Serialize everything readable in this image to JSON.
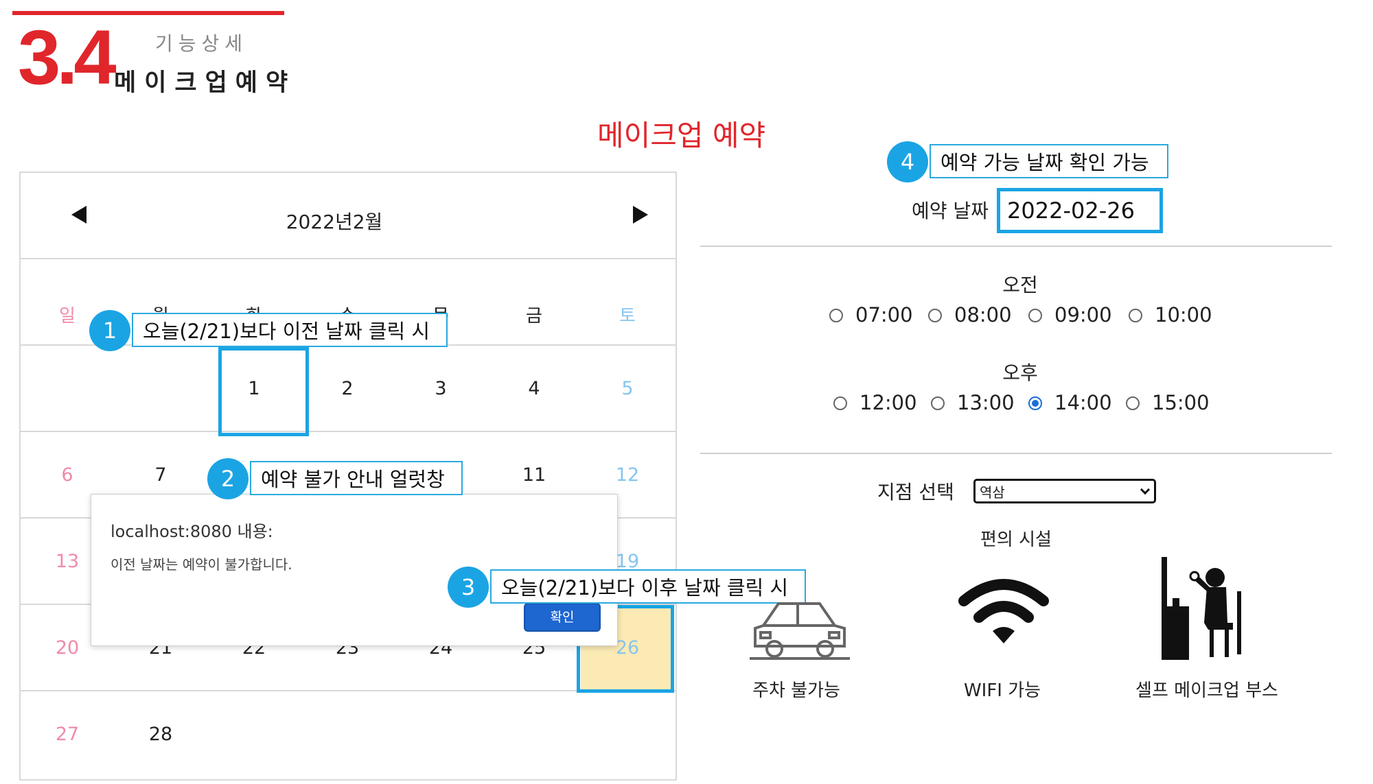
{
  "header": {
    "section_number": "3.4",
    "subtitle": "기능상세",
    "title": "메이크업예약"
  },
  "page_title": "메이크업 예약",
  "calendar": {
    "month_label": "2022년2월",
    "weekdays": [
      "일",
      "월",
      "화",
      "수",
      "목",
      "금",
      "토"
    ],
    "weeks": [
      [
        "",
        "",
        "1",
        "2",
        "3",
        "4",
        "5"
      ],
      [
        "6",
        "7",
        "",
        "",
        "",
        "11",
        "12"
      ],
      [
        "13",
        "",
        "",
        "",
        "",
        "",
        "19"
      ],
      [
        "20",
        "21",
        "22",
        "23",
        "24",
        "25",
        "26"
      ],
      [
        "27",
        "28",
        "",
        "",
        "",
        "",
        ""
      ]
    ],
    "selected_day": "26"
  },
  "alert": {
    "title": "localhost:8080 내용:",
    "message": "이전 날짜는 예약이 불가합니다.",
    "ok_label": "확인"
  },
  "callouts": [
    {
      "number": "1",
      "text": "오늘(2/21)보다 이전 날짜 클릭 시"
    },
    {
      "number": "2",
      "text": "예약 불가 안내 얼럿창"
    },
    {
      "number": "3",
      "text": "오늘(2/21)보다 이후 날짜 클릭 시"
    },
    {
      "number": "4",
      "text": "예약 가능 날짜 확인 가능"
    }
  ],
  "reservation": {
    "date_label": "예약 날짜",
    "date_value": "2022-02-26",
    "morning_label": "오전",
    "morning_times": [
      "07:00",
      "08:00",
      "09:00",
      "10:00"
    ],
    "afternoon_label": "오후",
    "afternoon_times": [
      "12:00",
      "13:00",
      "14:00",
      "15:00"
    ],
    "selected_time": "14:00",
    "branch_label": "지점 선택",
    "branch_value": "역삼",
    "facilities_title": "편의 시설",
    "facilities": [
      "주차 불가능",
      "WIFI 가능",
      "셀프 메이크업 부스"
    ]
  },
  "colors": {
    "accent_red": "#e0262b",
    "callout_blue": "#1ba4e4",
    "sunday_pink": "#f08aa8",
    "saturday_blue": "#86c5ef",
    "selected_day_bg": "#fbeab4",
    "radio_checked": "#1a6ed8"
  },
  "icons": [
    "car-icon",
    "wifi-icon",
    "makeup-booth-icon"
  ]
}
